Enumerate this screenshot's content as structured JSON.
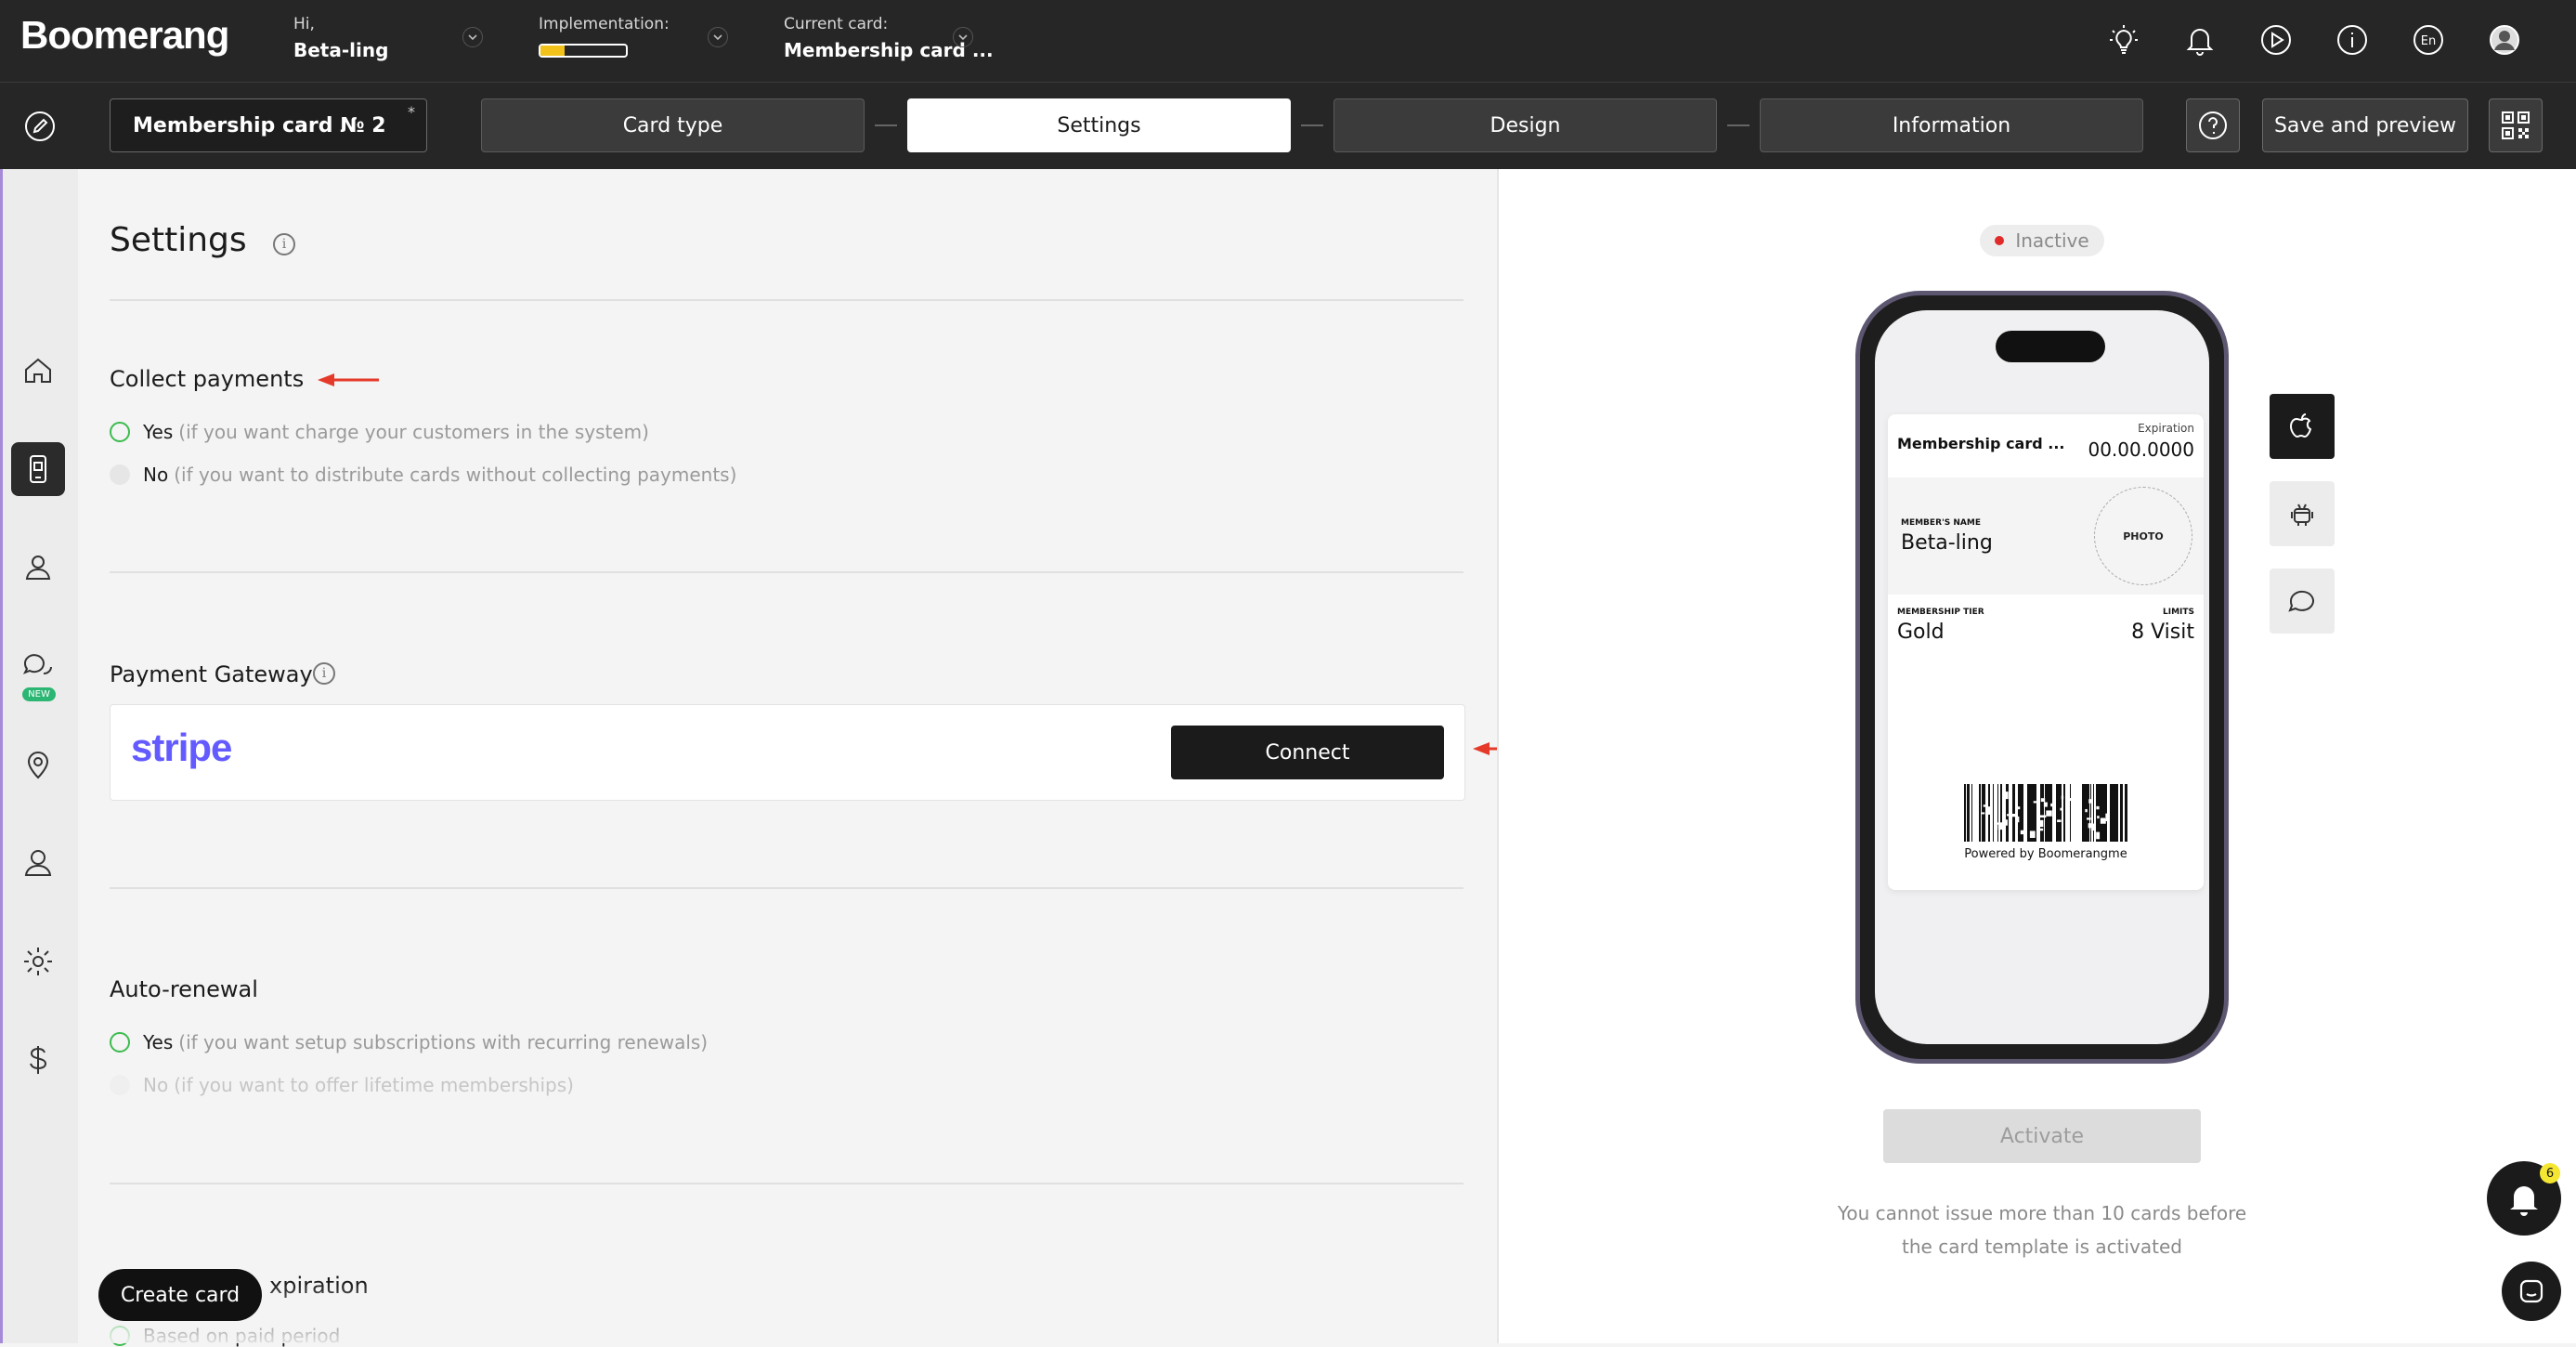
{
  "header": {
    "logo": "Boomerang",
    "greeting_small": "Hi,",
    "user_name": "Beta-ling",
    "implementation_label": "Implementation:",
    "implementation_progress": 0.28,
    "current_card_label": "Current card:",
    "current_card_value": "Membership card ...",
    "language": "En",
    "icons": [
      "lightbulb-icon",
      "bell-icon",
      "play-icon",
      "info-icon",
      "language-icon",
      "user-avatar"
    ]
  },
  "toolbar": {
    "card_name": "Membership card № 2",
    "card_name_marker": "*",
    "steps": [
      "Card type",
      "Settings",
      "Design",
      "Information"
    ],
    "active_step": "Settings",
    "save_preview": "Save and preview"
  },
  "sidebar": {
    "items": [
      "home",
      "cards",
      "customers",
      "messages",
      "locations",
      "managers",
      "settings",
      "billing"
    ],
    "active": "cards",
    "new_badge": "NEW"
  },
  "settings": {
    "title": "Settings",
    "collect_payments": {
      "title": "Collect payments",
      "yes_label": "Yes",
      "yes_hint": "(if you want charge your customers in the system)",
      "no_label": "No",
      "no_hint": "(if you want to distribute cards without collecting payments)"
    },
    "payment_gateway": {
      "title": "Payment Gateway",
      "provider": "stripe",
      "connect": "Connect"
    },
    "auto_renewal": {
      "title": "Auto-renewal",
      "yes_label": "Yes",
      "yes_hint": "(if you want setup subscriptions with recurring renewals)",
      "no_label": "No",
      "no_hint": "(if you want to offer lifetime memberships)"
    },
    "expiration": {
      "title_partial": "xpiration",
      "option_partial": "Based on paid period"
    },
    "create_card": "Create card"
  },
  "preview": {
    "status": "Inactive",
    "card": {
      "name": "Membership card ...",
      "expiration_label": "Expiration",
      "expiration_value": "00.00.0000",
      "member_name_label": "MEMBER'S NAME",
      "member_name": "Beta-ling",
      "photo_label": "PHOTO",
      "tier_label": "MEMBERSHIP TIER",
      "tier_value": "Gold",
      "limits_label": "LIMITS",
      "limits_value": "8 Visit",
      "powered_by": "Powered by Boomerangme"
    },
    "devices": [
      "apple",
      "android",
      "chat"
    ],
    "activate": "Activate",
    "note": "You cannot issue more than 10 cards before the card template is activated",
    "notifications_count": "6"
  },
  "colors": {
    "dark": "#262626",
    "accent_green": "#3dbb4f",
    "stripe": "#635bff",
    "progress": "#f2c21b",
    "arrow_red": "#e53a2a",
    "status_dot": "#e12b2b"
  }
}
